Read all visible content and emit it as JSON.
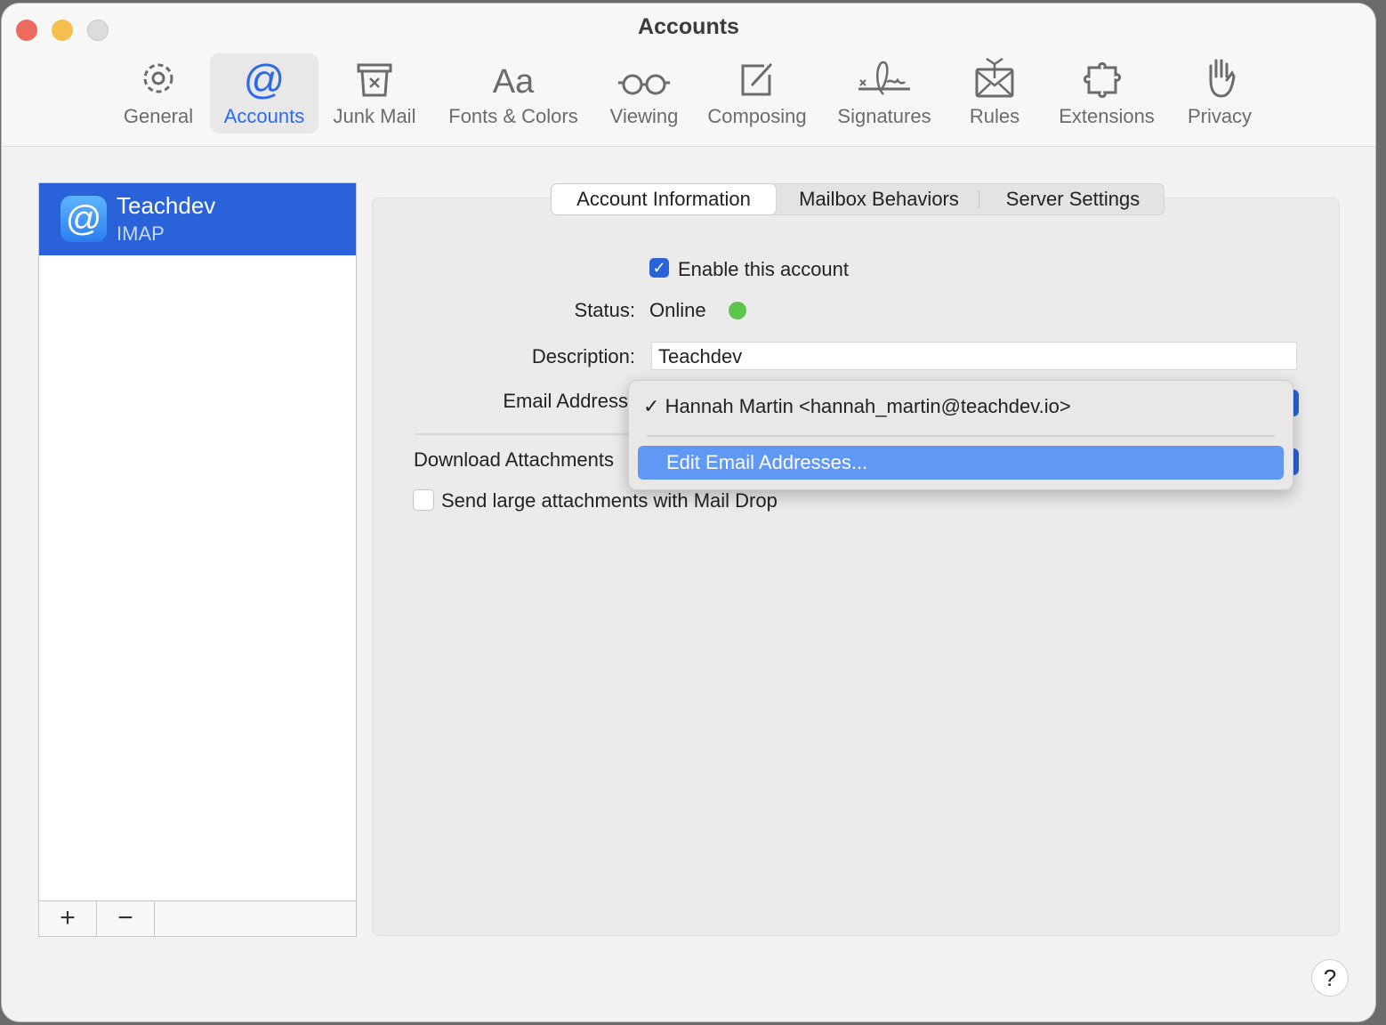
{
  "window": {
    "title": "Accounts"
  },
  "toolbar": {
    "items": [
      {
        "label": "General",
        "icon": "gear-icon"
      },
      {
        "label": "Accounts",
        "icon": "at-icon",
        "selected": true
      },
      {
        "label": "Junk Mail",
        "icon": "junk-bin-icon"
      },
      {
        "label": "Fonts & Colors",
        "icon": "fonts-icon"
      },
      {
        "label": "Viewing",
        "icon": "glasses-icon"
      },
      {
        "label": "Composing",
        "icon": "compose-icon"
      },
      {
        "label": "Signatures",
        "icon": "signature-icon"
      },
      {
        "label": "Rules",
        "icon": "rules-envelope-icon"
      },
      {
        "label": "Extensions",
        "icon": "puzzle-icon"
      },
      {
        "label": "Privacy",
        "icon": "hand-icon"
      }
    ]
  },
  "accounts": {
    "items": [
      {
        "name": "Teachdev",
        "type": "IMAP",
        "icon_glyph": "@"
      }
    ],
    "add": "+",
    "remove": "−"
  },
  "tabs": [
    {
      "label": "Account Information",
      "selected": true
    },
    {
      "label": "Mailbox Behaviors"
    },
    {
      "label": "Server Settings"
    }
  ],
  "form": {
    "enable_label": "Enable this account",
    "enable_checked": true,
    "status_label": "Status:",
    "status_value": "Online",
    "status_color": "#5ec44e",
    "description_label": "Description:",
    "description_value": "Teachdev",
    "email_label": "Email Address",
    "download_label": "Download Attachments",
    "maildrop_label": "Send large attachments with Mail Drop",
    "maildrop_checked": false
  },
  "email_menu": {
    "check": "✓",
    "selected": "Hannah Martin <hannah_martin@teachdev.io>",
    "edit": "Edit Email Addresses..."
  },
  "help": "?",
  "colors": {
    "accent": "#2a62d9",
    "menu_highlight": "#6098f5",
    "close": "#ec6a5e",
    "minimize": "#f4bf4f",
    "zoom": "#dcdcdc"
  }
}
